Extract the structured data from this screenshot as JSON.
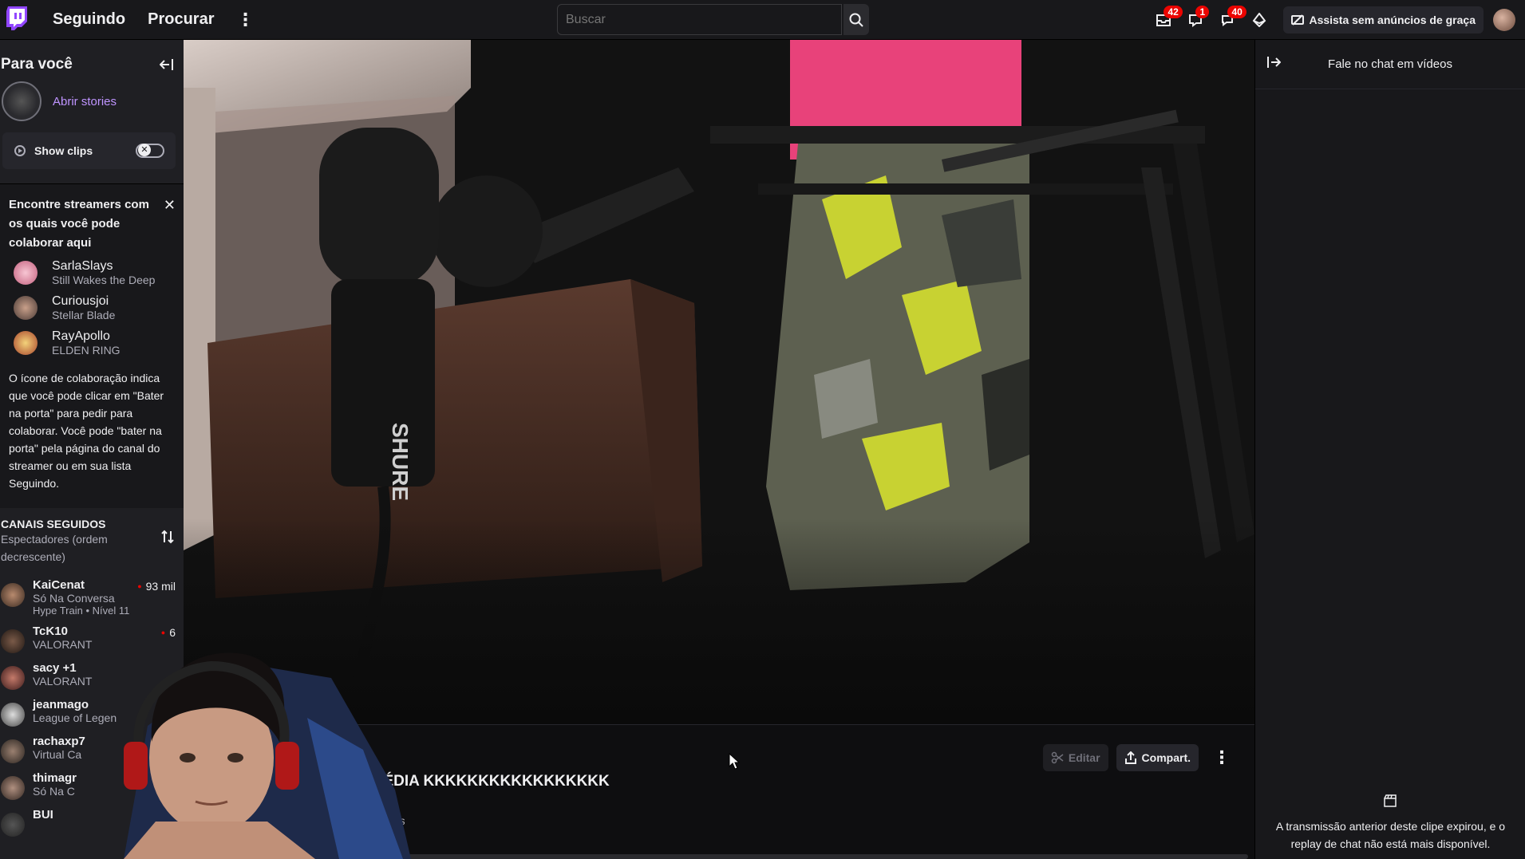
{
  "topbar": {
    "nav_following": "Seguindo",
    "nav_browse": "Procurar",
    "search_placeholder": "Buscar",
    "badges": {
      "inbox": "42",
      "whispers": "1",
      "notifications": "40"
    },
    "turbo_label": "Assista sem anúncios de graça"
  },
  "sidebar": {
    "title": "Para você",
    "stories_label": "Abrir stories",
    "show_clips": "Show clips",
    "collab": {
      "heading": "Encontre streamers com os quais você pode colaborar aqui",
      "streamers": [
        {
          "name": "SarlaSlays",
          "game": "Still Wakes the Deep"
        },
        {
          "name": "Curiousjoi",
          "game": "Stellar Blade"
        },
        {
          "name": "RayApollo",
          "game": "ELDEN RING"
        }
      ],
      "description": "O ícone de colaboração indica que você pode clicar em \"Bater na porta\" para pedir para colaborar. Você pode \"bater na porta\" pela página do canal do streamer ou em sua lista Seguindo."
    },
    "followed": {
      "title": "CANAIS SEGUIDOS",
      "sort": "Espectadores (ordem decrescente)",
      "channels": [
        {
          "name": "KaiCenat",
          "game": "Só Na Conversa",
          "extra": "Hype Train • Nível 11",
          "viewers": "93 mil"
        },
        {
          "name": "TcK10",
          "game": "VALORANT",
          "extra": "",
          "viewers": "6"
        },
        {
          "name": "sacy +1",
          "game": "VALORANT",
          "extra": "",
          "viewers": ""
        },
        {
          "name": "jeanmago",
          "game": "League of Legen",
          "extra": "",
          "viewers": ""
        },
        {
          "name": "rachaxp7",
          "game": "Virtual Ca",
          "extra": "",
          "viewers": ""
        },
        {
          "name": "thimagr",
          "game": "Só Na C",
          "extra": "",
          "viewers": ""
        },
        {
          "name": "BUI",
          "game": "",
          "extra": "",
          "viewers": ""
        }
      ]
    }
  },
  "video": {
    "mic_brand": "SHURE"
  },
  "clip": {
    "title": "AGÉDIA KKKKKKKKKKKKKKKKK",
    "subtitle": "ções",
    "edit_label": "Editar",
    "share_label": "Compart."
  },
  "chat": {
    "header": "Fale no chat em vídeos",
    "message": "A transmissão anterior deste clipe expirou, e o replay de chat não está mais disponível."
  },
  "colors": {
    "accent": "#9146ff",
    "live": "#eb0400",
    "background": "#0e0e10",
    "panel": "#18181b"
  }
}
